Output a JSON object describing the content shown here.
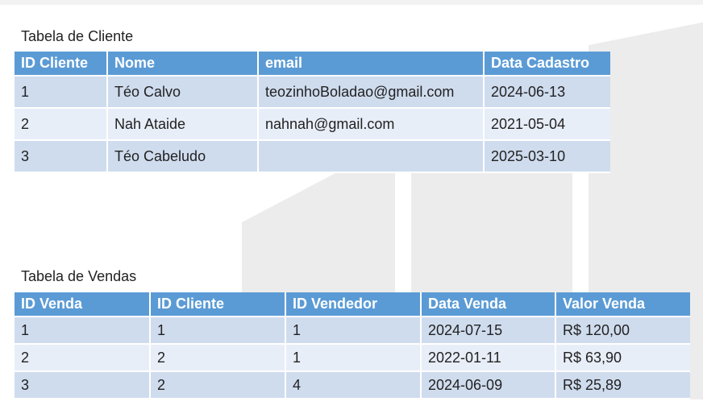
{
  "clientes": {
    "title": "Tabela de Cliente",
    "columns": [
      "ID Cliente",
      "Nome",
      "email",
      "Data Cadastro"
    ],
    "rows": [
      [
        "1",
        "Téo Calvo",
        "teozinhoBoladao@gmail.com",
        "2024-06-13"
      ],
      [
        "2",
        "Nah Ataide",
        "nahnah@gmail.com",
        "2021-05-04"
      ],
      [
        "3",
        "Téo Cabeludo",
        "",
        "2025-03-10"
      ]
    ]
  },
  "vendas": {
    "title": "Tabela de Vendas",
    "columns": [
      "ID Venda",
      "ID Cliente",
      "ID Vendedor",
      "Data Venda",
      "Valor Venda"
    ],
    "rows": [
      [
        "1",
        "1",
        "1",
        "2024-07-15",
        "R$ 120,00"
      ],
      [
        "2",
        "2",
        "1",
        "2022-01-11",
        "R$ 63,90"
      ],
      [
        "3",
        "2",
        "4",
        "2024-06-09",
        "R$ 25,89"
      ]
    ]
  },
  "colors": {
    "header": "#5b9bd5",
    "row_dark": "#cfdcee",
    "row_light": "#e8eef8"
  }
}
